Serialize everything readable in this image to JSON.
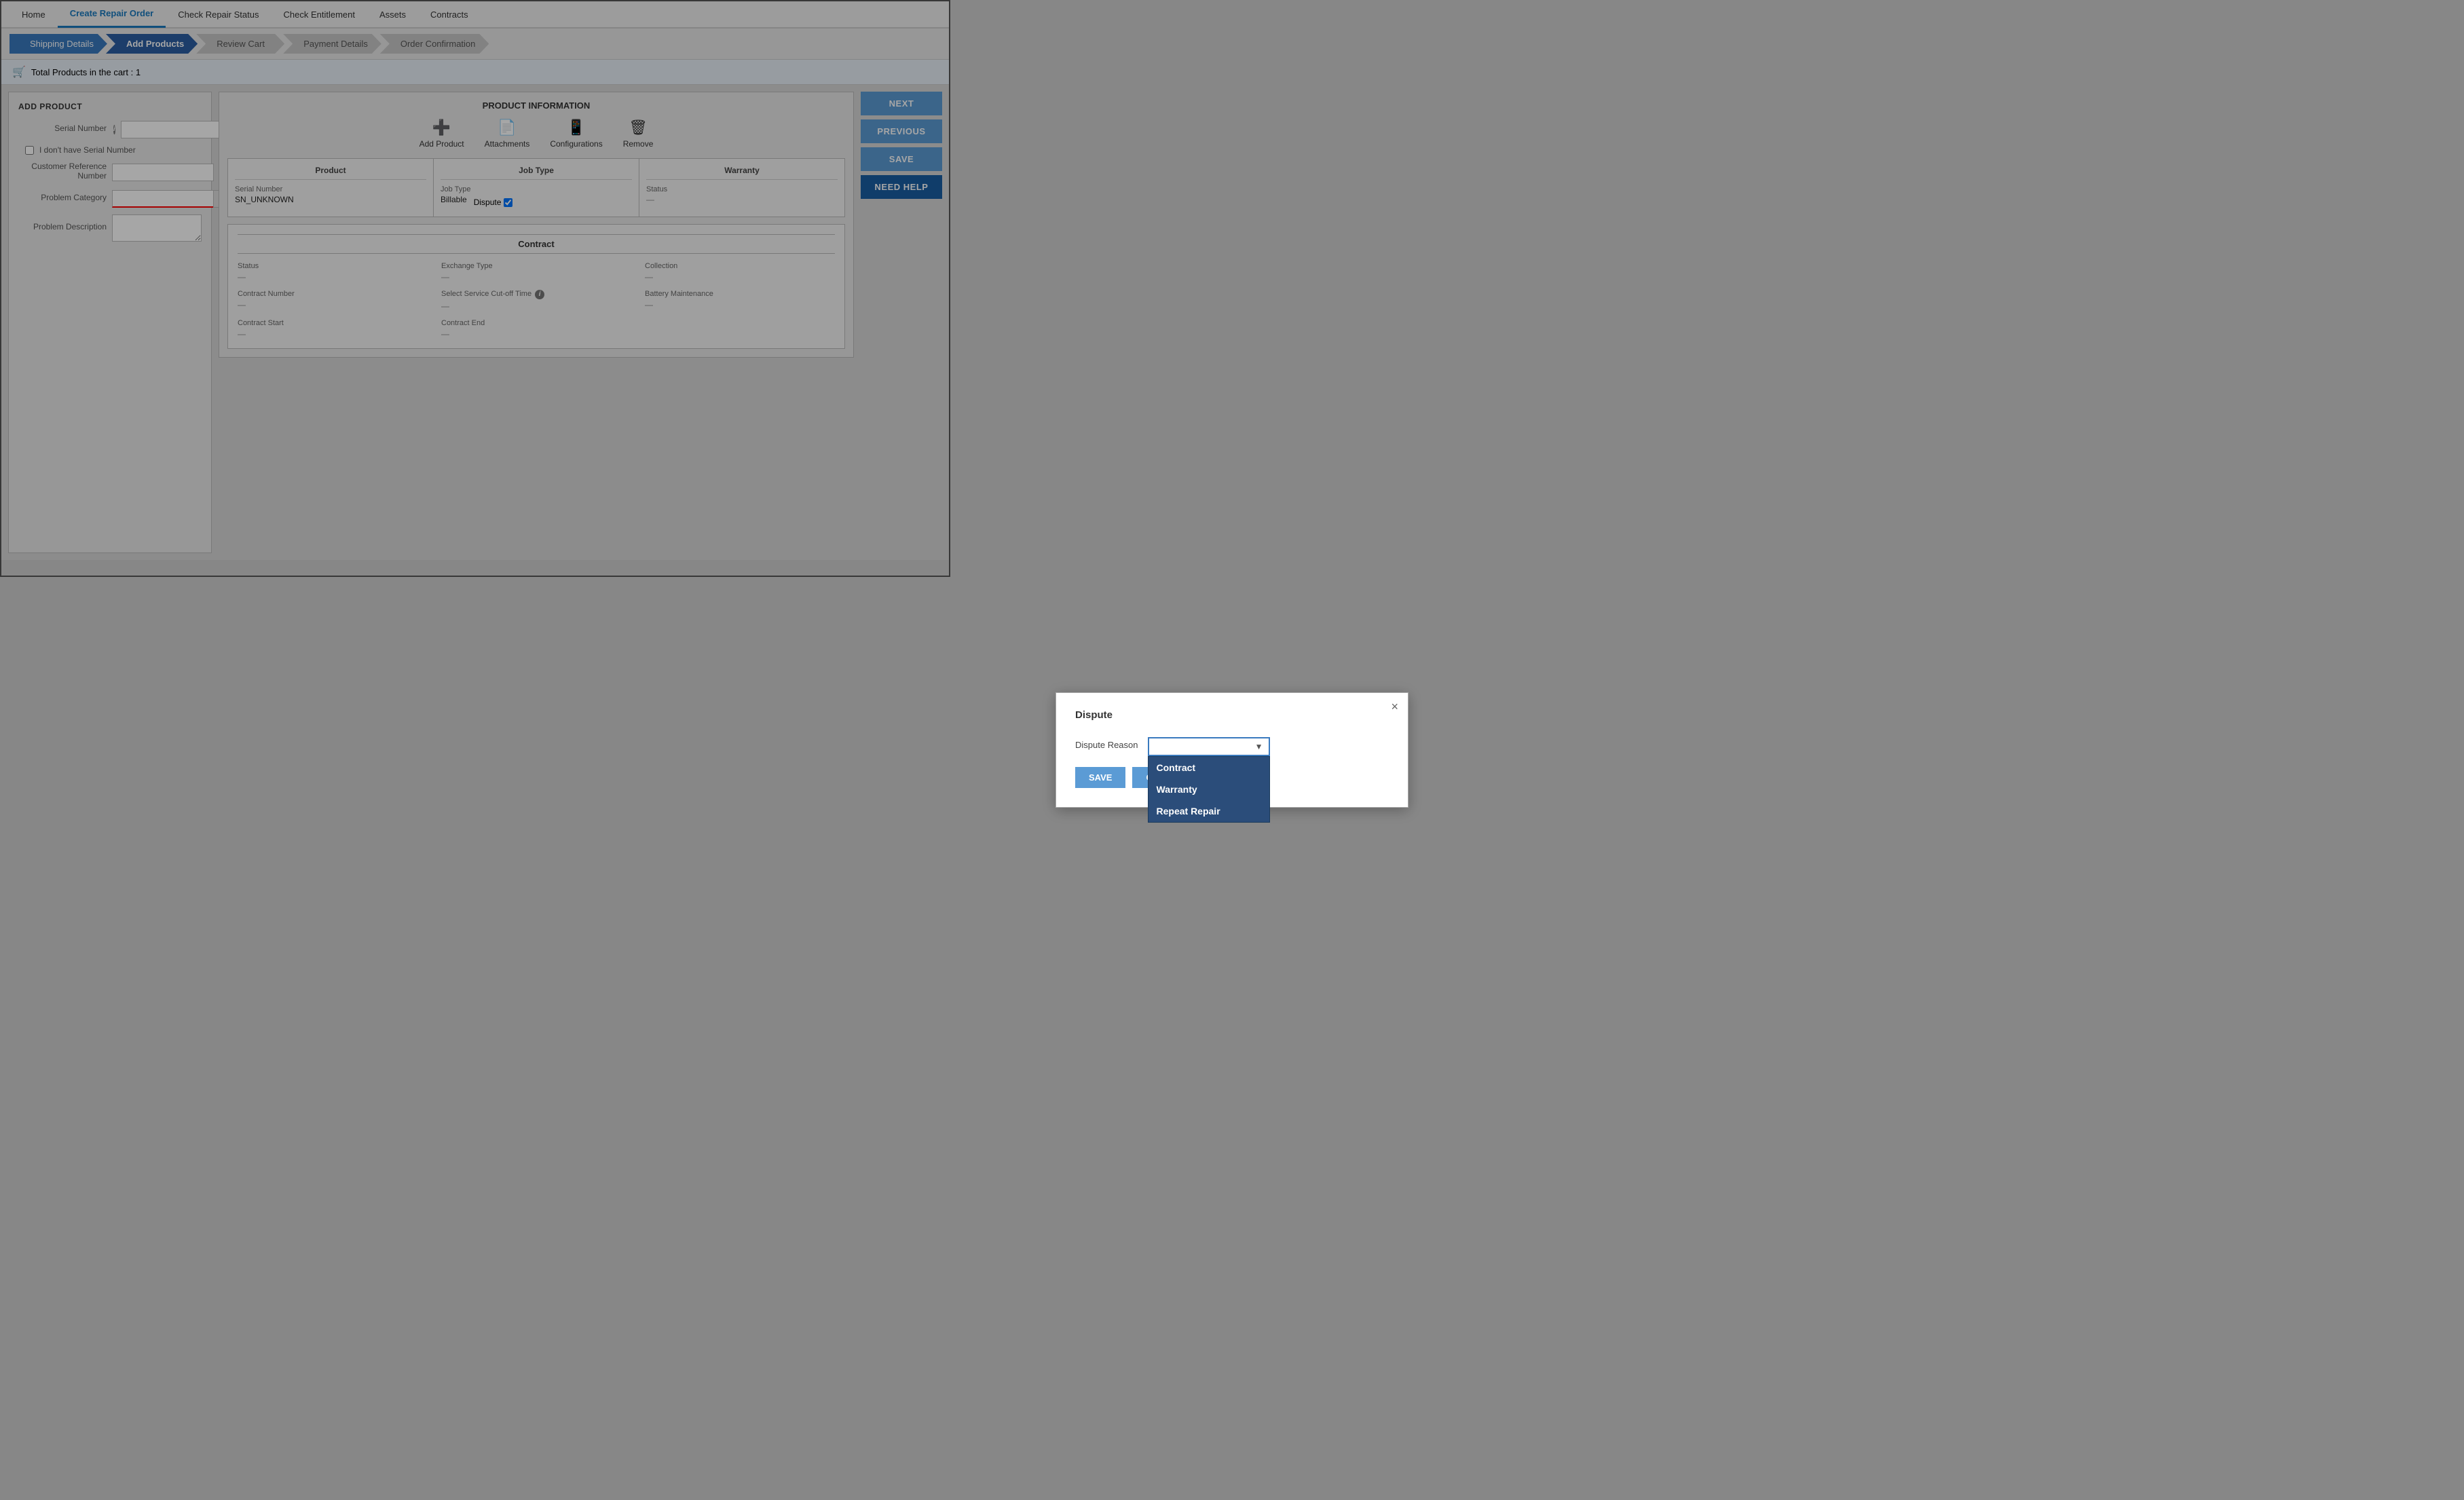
{
  "nav": {
    "items": [
      {
        "label": "Home",
        "active": false
      },
      {
        "label": "Create Repair Order",
        "active": true
      },
      {
        "label": "Check Repair Status",
        "active": false
      },
      {
        "label": "Check Entitlement",
        "active": false
      },
      {
        "label": "Assets",
        "active": false
      },
      {
        "label": "Contracts",
        "active": false
      }
    ]
  },
  "steps": [
    {
      "label": "Shipping Details",
      "state": "completed"
    },
    {
      "label": "Add Products",
      "state": "active"
    },
    {
      "label": "Review Cart",
      "state": "inactive"
    },
    {
      "label": "Payment Details",
      "state": "inactive"
    },
    {
      "label": "Order Confirmation",
      "state": "inactive"
    }
  ],
  "cart": {
    "banner": "Total Products in the cart : 1"
  },
  "left_panel": {
    "title": "ADD PRODUCT",
    "serial_number_label": "Serial Number",
    "no_serial_label": "I don't have Serial Number",
    "customer_ref_label": "Customer Reference Number",
    "problem_category_label": "Problem Category",
    "problem_description_label": "Problem Description"
  },
  "product_info": {
    "section_title": "PRODUCT INFORMATION",
    "actions": [
      {
        "label": "Add Product",
        "icon": "+"
      },
      {
        "label": "Attachments",
        "icon": "📄"
      },
      {
        "label": "Configurations",
        "icon": "📱"
      },
      {
        "label": "Remove",
        "icon": "🗑"
      }
    ],
    "product_col": {
      "header": "Product",
      "serial_number_label": "Serial Number",
      "serial_number_value": "SN_UNKNOWN"
    },
    "job_type_col": {
      "header": "Job Type",
      "job_type_label": "Job Type",
      "job_type_value": "Billable",
      "dispute_label": "Dispute",
      "dispute_checked": true
    },
    "warranty_col": {
      "header": "Warranty",
      "status_label": "Status",
      "status_value": "—"
    }
  },
  "contract": {
    "header": "Contract",
    "fields": [
      {
        "label": "Status",
        "value": "—"
      },
      {
        "label": "Exchange Type",
        "value": "—"
      },
      {
        "label": "Collection",
        "value": "—"
      },
      {
        "label": "Contract Number",
        "value": "—"
      },
      {
        "label": "Select Service Cut-off Time",
        "value": "—",
        "has_info": true
      },
      {
        "label": "Battery Maintenance",
        "value": "—"
      },
      {
        "label": "Contract Start",
        "value": "—"
      },
      {
        "label": "",
        "value": ""
      },
      {
        "label": "",
        "value": ""
      },
      {
        "label": "Contract End",
        "value": "—"
      },
      {
        "label": "",
        "value": ""
      },
      {
        "label": "",
        "value": ""
      }
    ]
  },
  "side_actions": {
    "next_label": "NEXT",
    "previous_label": "PREVIOUS",
    "save_label": "SAVE",
    "need_help_label": "NEED HELP"
  },
  "modal": {
    "title": "Dispute",
    "dispute_reason_label": "Dispute Reason",
    "close_label": "×",
    "save_label": "SAVE",
    "cancel_label": "CANCEL",
    "dropdown_options": [
      {
        "label": "Contract"
      },
      {
        "label": "Warranty"
      },
      {
        "label": "Repeat Repair"
      }
    ]
  }
}
